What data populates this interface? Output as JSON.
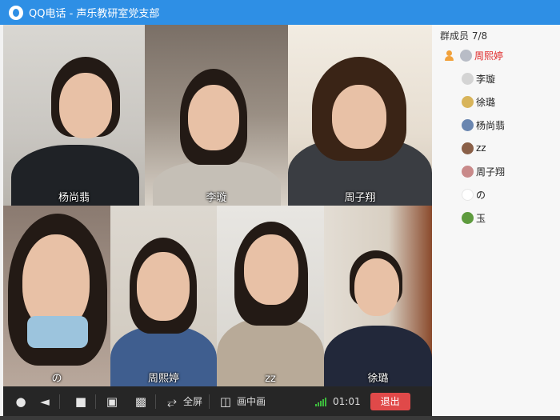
{
  "window": {
    "title": "QQ电话 - 声乐教研室党支部"
  },
  "participants": [
    {
      "name": "杨尚翡"
    },
    {
      "name": "李璇"
    },
    {
      "name": "周子翔"
    },
    {
      "name": "の"
    },
    {
      "name": "周熙婷"
    },
    {
      "name": "zz"
    },
    {
      "name": "徐璐"
    }
  ],
  "toolbar": {
    "mic_icon": "microphone-icon",
    "speaker_icon": "speaker-icon",
    "camera_icon": "camera-icon",
    "share_icon": "screen-share-icon",
    "present_icon": "present-icon",
    "fullscreen_label": "全屏",
    "pip_label": "画中画",
    "timer": "01:01",
    "exit_label": "退出",
    "signal_color": "#3dbb3d",
    "exit_color": "#e04949"
  },
  "members": {
    "header": "群成员 7/8",
    "list": [
      {
        "name": "周熙婷",
        "host": true,
        "color": "#e02b2b"
      },
      {
        "name": "李璇"
      },
      {
        "name": "徐璐"
      },
      {
        "name": "杨尚翡"
      },
      {
        "name": "zz"
      },
      {
        "name": "周子翔"
      },
      {
        "name": "の"
      },
      {
        "name": "玉"
      }
    ]
  },
  "colors": {
    "titlebar": "#2e8fe5",
    "toolbar": "#262626"
  }
}
